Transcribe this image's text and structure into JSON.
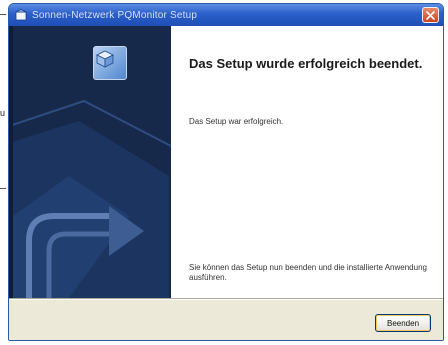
{
  "window": {
    "title": "Sonnen-Netzwerk PQMonitor Setup"
  },
  "colors": {
    "titlebar": "#2b5fc9",
    "side_panel": "#16294a",
    "accent": "#4f86cf",
    "close_button": "#c8451f"
  },
  "icons": {
    "title": "installer-icon",
    "app": "setup-box-icon",
    "close": "close-icon"
  },
  "content": {
    "heading": "Das Setup wurde erfolgreich beendet.",
    "status": "Das Setup war erfolgreich.",
    "instruction": "Sie können das Setup nun beenden und die installierte Anwendung ausführen."
  },
  "footer": {
    "finish_label": "Beenden"
  },
  "page_edge": {
    "letter": "u"
  }
}
